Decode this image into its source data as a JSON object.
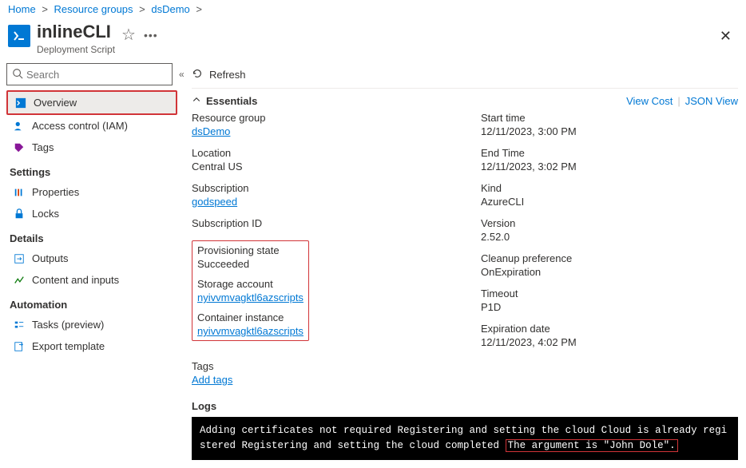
{
  "breadcrumb": [
    "Home",
    "Resource groups",
    "dsDemo"
  ],
  "header": {
    "title": "inlineCLI",
    "subtitle": "Deployment Script"
  },
  "sidebar": {
    "search_placeholder": "Search",
    "items": {
      "overview": "Overview",
      "access": "Access control (IAM)",
      "tags": "Tags"
    },
    "settings_label": "Settings",
    "settings": {
      "properties": "Properties",
      "locks": "Locks"
    },
    "details_label": "Details",
    "details": {
      "outputs": "Outputs",
      "content": "Content and inputs"
    },
    "automation_label": "Automation",
    "automation": {
      "tasks": "Tasks (preview)",
      "export": "Export template"
    }
  },
  "toolbar": {
    "refresh": "Refresh"
  },
  "essentials": {
    "header": "Essentials",
    "view_cost": "View Cost",
    "json_view": "JSON View",
    "left": {
      "resource_group_label": "Resource group",
      "resource_group_value": "dsDemo",
      "location_label": "Location",
      "location_value": "Central US",
      "subscription_label": "Subscription",
      "subscription_value": "godspeed",
      "subscription_id_label": "Subscription ID",
      "subscription_id_value": "",
      "provisioning_label": "Provisioning state",
      "provisioning_value": "Succeeded",
      "storage_label": "Storage account",
      "storage_value": "nyivvmvagktl6azscripts",
      "container_label": "Container instance",
      "container_value": "nyivvmvagktl6azscripts"
    },
    "right": {
      "start_label": "Start time",
      "start_value": "12/11/2023, 3:00 PM",
      "end_label": "End Time",
      "end_value": "12/11/2023, 3:02 PM",
      "kind_label": "Kind",
      "kind_value": "AzureCLI",
      "version_label": "Version",
      "version_value": "2.52.0",
      "cleanup_label": "Cleanup preference",
      "cleanup_value": "OnExpiration",
      "timeout_label": "Timeout",
      "timeout_value": "P1D",
      "expiration_label": "Expiration date",
      "expiration_value": "12/11/2023, 4:02 PM"
    },
    "tags_label": "Tags",
    "tags_value": "Add tags"
  },
  "logs": {
    "label": "Logs",
    "text_pre": "Adding certificates not required Registering and setting the cloud Cloud is already registered Registering and setting the cloud completed ",
    "text_highlight": "The argument is \"John Dole\"."
  }
}
